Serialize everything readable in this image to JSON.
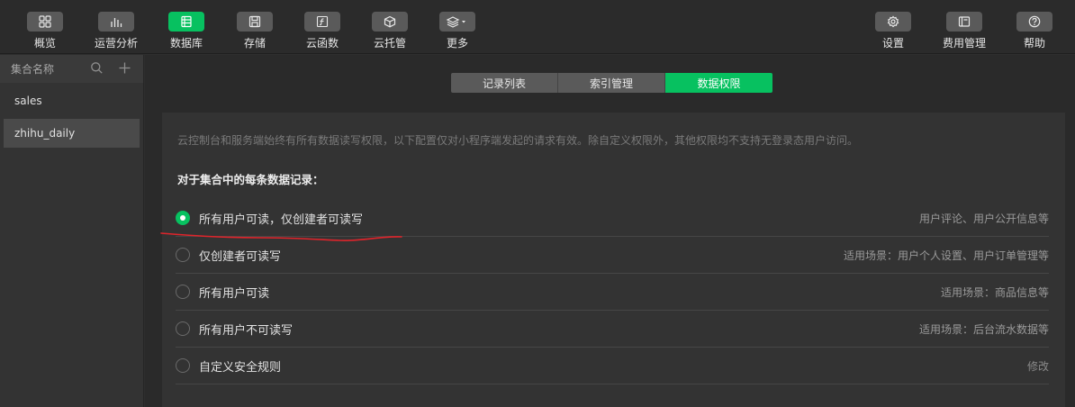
{
  "toolbar": {
    "left": [
      {
        "label": "概览",
        "icon": "overview-grid-icon"
      },
      {
        "label": "运营分析",
        "icon": "bar-chart-icon"
      },
      {
        "label": "数据库",
        "icon": "database-icon",
        "active": true
      },
      {
        "label": "存储",
        "icon": "storage-save-icon"
      },
      {
        "label": "云函数",
        "icon": "function-icon"
      },
      {
        "label": "云托管",
        "icon": "container-box-icon"
      },
      {
        "label": "更多",
        "icon": "layers-dropdown-icon"
      }
    ],
    "right": [
      {
        "label": "设置",
        "icon": "gear-icon"
      },
      {
        "label": "费用管理",
        "icon": "billing-icon"
      },
      {
        "label": "帮助",
        "icon": "help-icon"
      }
    ]
  },
  "sidebar": {
    "header": "集合名称",
    "items": [
      {
        "label": "sales"
      },
      {
        "label": "zhihu_daily",
        "selected": true
      }
    ]
  },
  "tabs": [
    {
      "label": "记录列表"
    },
    {
      "label": "索引管理"
    },
    {
      "label": "数据权限",
      "active": true
    }
  ],
  "permissions": {
    "notice": "云控制台和服务端始终有所有数据读写权限，以下配置仅对小程序端发起的请求有效。除自定义权限外，其他权限均不支持无登录态用户访问。",
    "subtitle": "对于集合中的每条数据记录：",
    "options": [
      {
        "label": "所有用户可读，仅创建者可读写",
        "hint": "用户评论、用户公开信息等",
        "checked": true
      },
      {
        "label": "仅创建者可读写",
        "hint": "适用场景：用户个人设置、用户订单管理等"
      },
      {
        "label": "所有用户可读",
        "hint": "适用场景：商品信息等"
      },
      {
        "label": "所有用户不可读写",
        "hint": "适用场景：后台流水数据等"
      },
      {
        "label": "自定义安全规则",
        "hint": "修改"
      }
    ]
  },
  "colors": {
    "accent": "#07c160",
    "annotation": "#e0242b"
  }
}
